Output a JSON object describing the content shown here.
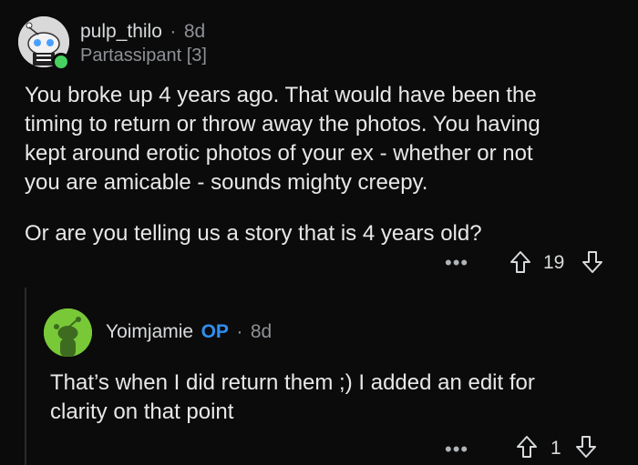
{
  "comment": {
    "username": "pulp_thilo",
    "age": "8d",
    "flair": "Partassipant [3]",
    "body_lines": [
      "You broke up 4 years ago. That would have been the",
      "timing to return or throw away the photos. You having",
      "kept around erotic photos of your ex - whether or not",
      "you are amicable - sounds mighty creepy.",
      "Or are you telling us a story that is 4 years old?"
    ],
    "score": "19",
    "more": "•••"
  },
  "reply": {
    "username": "Yoimjamie",
    "op_badge": "OP",
    "age": "8d",
    "body_lines": [
      "That’s when I did return them ;) I added an edit for",
      "clarity on that point"
    ],
    "score": "1",
    "more": "•••"
  },
  "separator": "·",
  "colors": {
    "online": "#46d160",
    "op": "#2e8ff0",
    "avatar2": "#78c838"
  }
}
